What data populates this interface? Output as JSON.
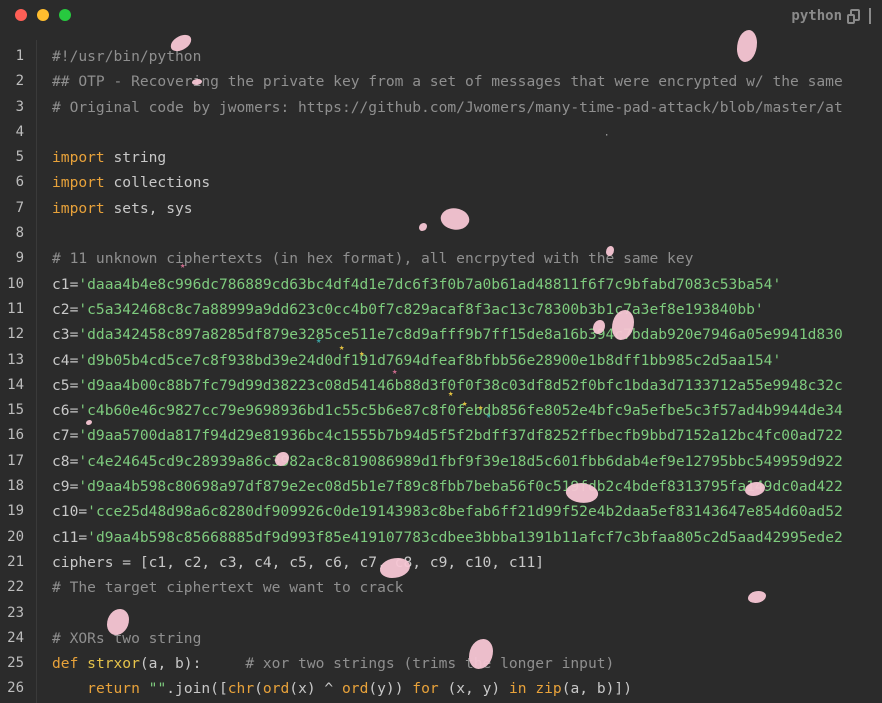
{
  "window": {
    "language": "python"
  },
  "lines": [
    {
      "n": "1",
      "tokens": [
        {
          "t": "comment",
          "v": "#!/usr/bin/python"
        }
      ]
    },
    {
      "n": "2",
      "tokens": [
        {
          "t": "comment",
          "v": "## OTP - Recovering the private key from a set of messages that were encrypted w/ the same"
        }
      ]
    },
    {
      "n": "3",
      "tokens": [
        {
          "t": "comment",
          "v": "# Original code by jwomers: https://github.com/Jwomers/many-time-pad-attack/blob/master/at"
        }
      ]
    },
    {
      "n": "4",
      "tokens": []
    },
    {
      "n": "5",
      "tokens": [
        {
          "t": "kw",
          "v": "import"
        },
        {
          "t": "plain",
          "v": " string"
        }
      ]
    },
    {
      "n": "6",
      "tokens": [
        {
          "t": "kw",
          "v": "import"
        },
        {
          "t": "plain",
          "v": " collections"
        }
      ]
    },
    {
      "n": "7",
      "tokens": [
        {
          "t": "kw",
          "v": "import"
        },
        {
          "t": "plain",
          "v": " sets, sys"
        }
      ]
    },
    {
      "n": "8",
      "tokens": []
    },
    {
      "n": "9",
      "tokens": [
        {
          "t": "comment",
          "v": "# 11 unknown ciphertexts (in hex format), all encrpyted with the same key"
        }
      ]
    },
    {
      "n": "10",
      "tokens": [
        {
          "t": "plain",
          "v": "c1="
        },
        {
          "t": "str",
          "v": "'daaa4b4e8c996dc786889cd63bc4df4d1e7dc6f3f0b7a0b61ad48811f6f7c9bfabd7083c53ba54'"
        }
      ]
    },
    {
      "n": "11",
      "tokens": [
        {
          "t": "plain",
          "v": "c2="
        },
        {
          "t": "str",
          "v": "'c5a342468c8c7a88999a9dd623c0cc4b0f7c829acaf8f3ac13c78300b3b1c7a3ef8e193840bb'"
        }
      ]
    },
    {
      "n": "12",
      "tokens": [
        {
          "t": "plain",
          "v": "c3="
        },
        {
          "t": "str",
          "v": "'dda342458c897a8285df879e3285ce511e7c8d9afff9b7ff15de8a16b394c7bdab920e7946a05e9941d830"
        }
      ]
    },
    {
      "n": "13",
      "tokens": [
        {
          "t": "plain",
          "v": "c4="
        },
        {
          "t": "str",
          "v": "'d9b05b4cd5ce7c8f938bd39e24d0df191d7694dfeaf8bfbb56e28900e1b8dff1bb985c2d5aa154'"
        }
      ]
    },
    {
      "n": "14",
      "tokens": [
        {
          "t": "plain",
          "v": "c5="
        },
        {
          "t": "str",
          "v": "'d9aa4b00c88b7fc79d99d38223c08d54146b88d3f0f0f38c03df8d52f0bfc1bda3d7133712a55e9948c32c"
        }
      ]
    },
    {
      "n": "15",
      "tokens": [
        {
          "t": "plain",
          "v": "c6="
        },
        {
          "t": "str",
          "v": "'c4b60e46c9827cc79e9698936bd1c55c5b6e87c8f0febdb856fe8052e4bfc9a5efbe5c3f57ad4b9944de34"
        }
      ]
    },
    {
      "n": "16",
      "tokens": [
        {
          "t": "plain",
          "v": "c7="
        },
        {
          "t": "str",
          "v": "'d9aa5700da817f94d29e81936bc4c1555b7b94d5f5f2bdff37df8252ffbecfb9bbd7152a12bc4fc00ad722"
        }
      ]
    },
    {
      "n": "17",
      "tokens": [
        {
          "t": "plain",
          "v": "c8="
        },
        {
          "t": "str",
          "v": "'c4e24645cd9c28939a86c3982ac8c819086989d1fbf9f39e18d5c601fbb6dab4ef9e12795bbc549959d922"
        }
      ]
    },
    {
      "n": "18",
      "tokens": [
        {
          "t": "plain",
          "v": "c9="
        },
        {
          "t": "str",
          "v": "'d9aa4b598c80698a97df879e2ec08d5b1e7f89c8fbb7beba56f0c519fdb2c4bdef8313795fa149dc0ad422"
        }
      ]
    },
    {
      "n": "19",
      "tokens": [
        {
          "t": "plain",
          "v": "c10="
        },
        {
          "t": "str",
          "v": "'cce25d48d98a6c8280df909926c0de19143983c8befab6ff21d99f52e4b2daa5ef83143647e854d60ad52"
        }
      ]
    },
    {
      "n": "20",
      "tokens": [
        {
          "t": "plain",
          "v": "c11="
        },
        {
          "t": "str",
          "v": "'d9aa4b598c85668885df9d993f85e419107783cdbee3bbba1391b11afcf7c3bfaa805c2d5aad42995ede2"
        }
      ]
    },
    {
      "n": "21",
      "tokens": [
        {
          "t": "plain",
          "v": "ciphers = [c1, c2, c3, c4, c5, c6, c7, c8, c9, c10, c11]"
        }
      ]
    },
    {
      "n": "22",
      "tokens": [
        {
          "t": "comment",
          "v": "# The target ciphertext we want to crack"
        }
      ]
    },
    {
      "n": "23",
      "tokens": []
    },
    {
      "n": "24",
      "tokens": [
        {
          "t": "comment",
          "v": "# XORs two string"
        }
      ]
    },
    {
      "n": "25",
      "tokens": [
        {
          "t": "kw",
          "v": "def"
        },
        {
          "t": "plain",
          "v": " "
        },
        {
          "t": "fn",
          "v": "strxor"
        },
        {
          "t": "plain",
          "v": "(a, b):     "
        },
        {
          "t": "comment",
          "v": "# xor two strings (trims the longer input)"
        }
      ]
    },
    {
      "n": "26",
      "tokens": [
        {
          "t": "plain",
          "v": "    "
        },
        {
          "t": "kw",
          "v": "return"
        },
        {
          "t": "plain",
          "v": " "
        },
        {
          "t": "str",
          "v": "\"\""
        },
        {
          "t": "plain",
          "v": ".join(["
        },
        {
          "t": "kw",
          "v": "chr"
        },
        {
          "t": "plain",
          "v": "("
        },
        {
          "t": "kw",
          "v": "ord"
        },
        {
          "t": "plain",
          "v": "(x) ^ "
        },
        {
          "t": "kw",
          "v": "ord"
        },
        {
          "t": "plain",
          "v": "(y)) "
        },
        {
          "t": "kw",
          "v": "for"
        },
        {
          "t": "plain",
          "v": " (x, y) "
        },
        {
          "t": "kw",
          "v": "in"
        },
        {
          "t": "plain",
          "v": " "
        },
        {
          "t": "kw",
          "v": "zip"
        },
        {
          "t": "plain",
          "v": "(a, b)])"
        }
      ]
    }
  ],
  "colors": {
    "background": "#2b2b2b",
    "comment": "#8f8f8f",
    "keyword": "#e8a23a",
    "string": "#7ecb7e",
    "function": "#e6c34a",
    "petal": "#f7c6d4"
  }
}
